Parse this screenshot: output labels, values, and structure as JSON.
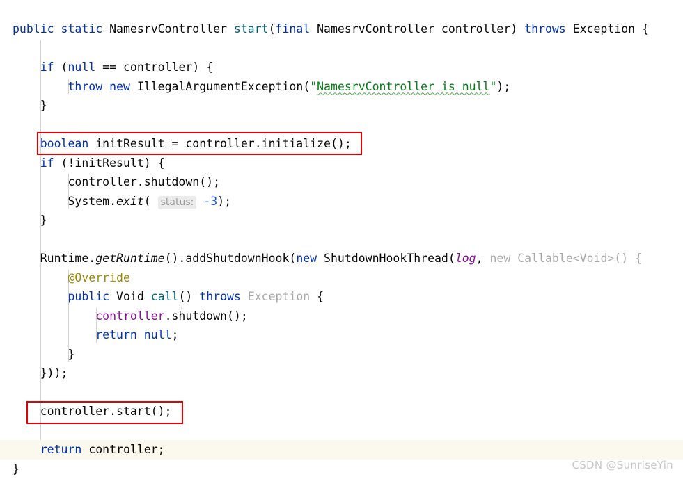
{
  "editor": {
    "language": "java",
    "background": "#ffffff",
    "current_line_highlight": "#fbf8ee",
    "font_size_px": 16.5,
    "line_height_px": 27.5
  },
  "colors": {
    "keyword": "#0033b3",
    "string": "#067d17",
    "number": "#1750eb",
    "annotation": "#9e880d",
    "grayed_out": "#a9a9a9",
    "static_field": "#871094",
    "method_call": "#00627a",
    "default_text": "#080808",
    "indent_guide": "#d3d3d3",
    "highlight_box": "#e60000",
    "param_hint_bg": "#ebebeb",
    "param_hint_fg": "#999999",
    "watermark": "#c8c8c8"
  },
  "code": {
    "lines": [
      {
        "n": 1,
        "text": "public static NamesrvController start(final NamesrvController controller) throws Exception {"
      },
      {
        "n": 2,
        "text": ""
      },
      {
        "n": 3,
        "text": "    if (null == controller) {"
      },
      {
        "n": 4,
        "text": "        throw new IllegalArgumentException(\"NamesrvController is null\");"
      },
      {
        "n": 5,
        "text": "    }"
      },
      {
        "n": 6,
        "text": ""
      },
      {
        "n": 7,
        "text": "    boolean initResult = controller.initialize();"
      },
      {
        "n": 8,
        "text": "    if (!initResult) {"
      },
      {
        "n": 9,
        "text": "        controller.shutdown();"
      },
      {
        "n": 10,
        "text": "        System.exit( status: -3);"
      },
      {
        "n": 11,
        "text": "    }"
      },
      {
        "n": 12,
        "text": ""
      },
      {
        "n": 13,
        "text": "    Runtime.getRuntime().addShutdownHook(new ShutdownHookThread(log, new Callable<Void>() {"
      },
      {
        "n": 14,
        "text": "        @Override"
      },
      {
        "n": 15,
        "text": "        public Void call() throws Exception {"
      },
      {
        "n": 16,
        "text": "            controller.shutdown();"
      },
      {
        "n": 17,
        "text": "            return null;"
      },
      {
        "n": 18,
        "text": "        }"
      },
      {
        "n": 19,
        "text": "    }));"
      },
      {
        "n": 20,
        "text": ""
      },
      {
        "n": 21,
        "text": "    controller.start();"
      },
      {
        "n": 22,
        "text": ""
      },
      {
        "n": 23,
        "text": "    return controller;"
      },
      {
        "n": 24,
        "text": "}"
      }
    ],
    "current_line": 23,
    "parameter_hint": "status:",
    "string_literal": "\"NamesrvController is null\"",
    "annotation_text": "@Override"
  },
  "highlights": [
    {
      "id": "highlight-init-result",
      "label": "boolean initResult = controller.initialize();",
      "color": "#e60000"
    },
    {
      "id": "highlight-controller-start",
      "label": "controller.start();",
      "color": "#e60000"
    }
  ],
  "watermark": {
    "text": "CSDN @SunriseYin"
  }
}
